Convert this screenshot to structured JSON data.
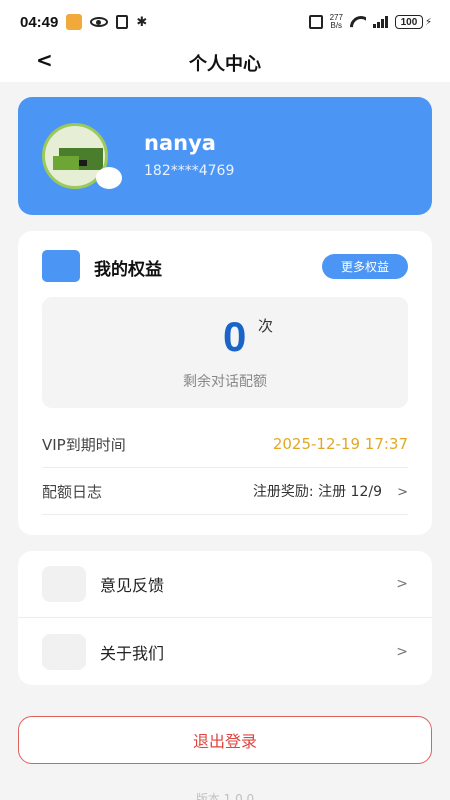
{
  "status_bar": {
    "time": "04:49",
    "net_speed_value": "277",
    "net_speed_unit": "B/s",
    "battery": "100"
  },
  "nav": {
    "back": "<",
    "title": "个人中心"
  },
  "profile": {
    "name": "nanya",
    "phone": "182****4769"
  },
  "rights": {
    "title": "我的权益",
    "more_button": "更多权益",
    "quota_count": "0",
    "quota_unit": "次",
    "quota_label": "剩余对话配额",
    "vip_label": "VIP到期时间",
    "vip_value": "2025-12-19 17:37",
    "log_label": "配额日志",
    "log_value": "注册奖励: 注册 12/9",
    "chevron": ">"
  },
  "menu": {
    "items": [
      {
        "label": "意见反馈",
        "chevron": ">"
      },
      {
        "label": "关于我们",
        "chevron": ">"
      }
    ]
  },
  "logout": "退出登录",
  "version": "版本 1.0.0",
  "colors": {
    "accent": "#4b95f5",
    "quota_number": "#1a63c7",
    "vip_date": "#e2a825",
    "logout": "#e0453f"
  }
}
